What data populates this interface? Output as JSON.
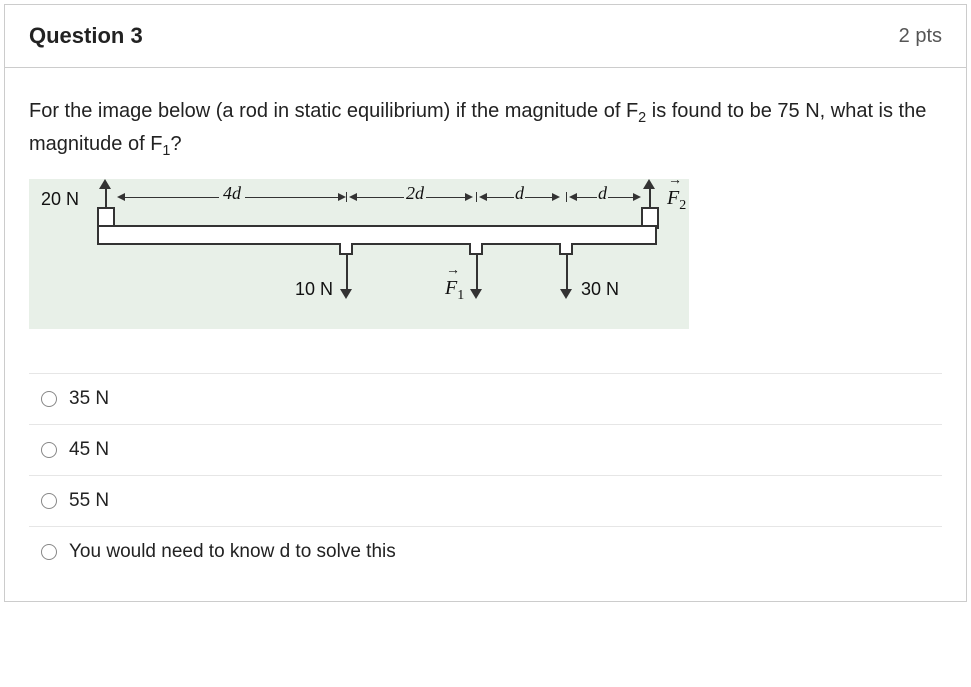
{
  "header": {
    "title": "Question 3",
    "points": "2 pts"
  },
  "prompt": {
    "part1": "For the image below (a rod in static equilibrium) if the magnitude of F",
    "sub1": "2",
    "part2": " is found to be 75 N, what is the magnitude of F",
    "sub2": "1",
    "part3": "?"
  },
  "diagram": {
    "left_force": "20 N",
    "right_force_name": "F",
    "right_force_sub": "2",
    "seg1": "4d",
    "seg2": "2d",
    "seg3": "d",
    "seg4": "d",
    "down1": "10 N",
    "down2_name": "F",
    "down2_sub": "1",
    "down3": "30 N"
  },
  "options": [
    {
      "label": "35 N"
    },
    {
      "label": "45 N"
    },
    {
      "label": "55 N"
    },
    {
      "label": "You would need to know d to solve this"
    }
  ]
}
